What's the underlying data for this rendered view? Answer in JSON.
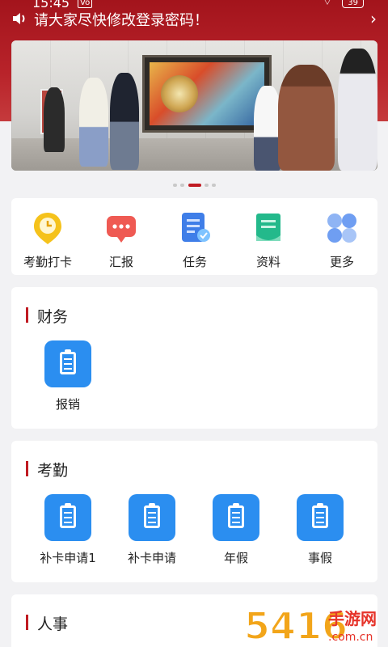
{
  "status": {
    "time": "15:45",
    "network": "Vo",
    "battery": "39"
  },
  "notice": {
    "icon": "speaker-icon",
    "text": "请大家尽快修改登录密码！",
    "chevron": "›"
  },
  "banner": {
    "pages": 5,
    "active_page": 3
  },
  "quick_menu": [
    {
      "label": "考勤打卡",
      "icon": "clock-icon"
    },
    {
      "label": "汇报",
      "icon": "chat-icon"
    },
    {
      "label": "任务",
      "icon": "task-icon"
    },
    {
      "label": "资料",
      "icon": "document-icon"
    },
    {
      "label": "更多",
      "icon": "grid-icon"
    }
  ],
  "sections": {
    "finance": {
      "title": "财务",
      "items": [
        {
          "label": "报销"
        }
      ]
    },
    "attendance": {
      "title": "考勤",
      "items": [
        {
          "label": "补卡申请1"
        },
        {
          "label": "补卡申请"
        },
        {
          "label": "年假"
        },
        {
          "label": "事假"
        }
      ]
    },
    "hr": {
      "title": "人事"
    }
  },
  "watermark": {
    "number": "5416",
    "text1": "手游网",
    "text2": ".com.cn"
  },
  "colors": {
    "brand_red": "#c01b22",
    "tile_blue": "#2b8ef0",
    "page_bg": "#f2f2f4"
  }
}
